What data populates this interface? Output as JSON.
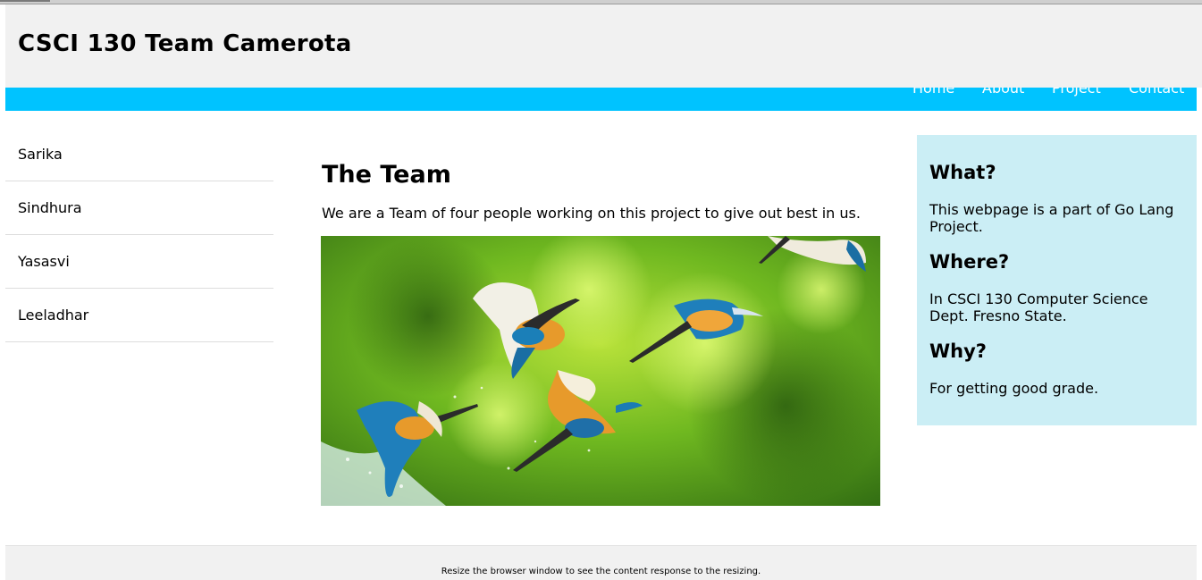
{
  "header": {
    "title": "CSCI 130 Team Camerota"
  },
  "nav": {
    "items": [
      {
        "label": "Home"
      },
      {
        "label": "About"
      },
      {
        "label": "Project"
      },
      {
        "label": "Contact"
      }
    ]
  },
  "sidebar": {
    "items": [
      {
        "label": "Sarika"
      },
      {
        "label": "Sindhura"
      },
      {
        "label": "Yasasvi"
      },
      {
        "label": "Leeladhar"
      }
    ]
  },
  "main": {
    "heading": "The Team",
    "intro": "We are a Team of four people working on this project to give out best in us."
  },
  "aside": {
    "what_heading": "What?",
    "what_text": "This webpage is a part of Go Lang Project.",
    "where_heading": "Where?",
    "where_text": "In CSCI 130 Computer Science Dept. Fresno State.",
    "why_heading": "Why?",
    "why_text": "For getting good grade."
  },
  "footer": {
    "text": "Resize the browser window to see the content response to the resizing."
  },
  "colors": {
    "nav_bar": "#00c3ff",
    "aside_bg": "#cbeef5",
    "header_bg": "#f1f1f1"
  }
}
